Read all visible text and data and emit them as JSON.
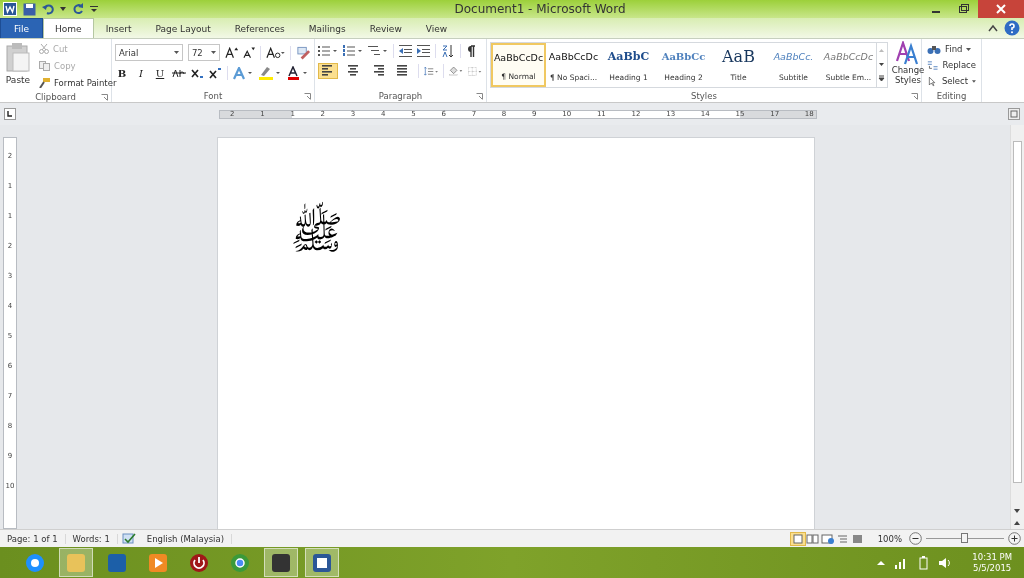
{
  "window": {
    "title": "Document1 - Microsoft Word"
  },
  "tabs": [
    {
      "label": "File",
      "kind": "file",
      "selected": false
    },
    {
      "label": "Home",
      "kind": "tab",
      "selected": true
    },
    {
      "label": "Insert",
      "kind": "tab",
      "selected": false
    },
    {
      "label": "Page Layout",
      "kind": "tab",
      "selected": false
    },
    {
      "label": "References",
      "kind": "tab",
      "selected": false
    },
    {
      "label": "Mailings",
      "kind": "tab",
      "selected": false
    },
    {
      "label": "Review",
      "kind": "tab",
      "selected": false
    },
    {
      "label": "View",
      "kind": "tab",
      "selected": false
    }
  ],
  "clipboard": {
    "paste": "Paste",
    "cut": "Cut",
    "copy": "Copy",
    "format_painter": "Format Painter",
    "label": "Clipboard"
  },
  "font": {
    "name": "Arial",
    "size": "72",
    "label": "Font",
    "bold": "B",
    "italic": "I",
    "underline": "U"
  },
  "paragraph": {
    "label": "Paragraph",
    "alignments": [
      {
        "kind": "left",
        "selected": true
      },
      {
        "kind": "center",
        "selected": false
      },
      {
        "kind": "right",
        "selected": false
      },
      {
        "kind": "justify",
        "selected": false
      }
    ]
  },
  "styles": {
    "label": "Styles",
    "items": [
      {
        "sample": "AaBbCcDc",
        "name": "¶ Normal",
        "kind": "normal",
        "selected": true
      },
      {
        "sample": "AaBbCcDc",
        "name": "¶ No Spaci...",
        "kind": "normal",
        "selected": false
      },
      {
        "sample": "AaBbC",
        "name": "Heading 1",
        "kind": "heading1",
        "selected": false
      },
      {
        "sample": "AaBbCc",
        "name": "Heading 2",
        "kind": "heading2",
        "selected": false
      },
      {
        "sample": "AaB",
        "name": "Title",
        "kind": "title",
        "selected": false
      },
      {
        "sample": "AaBbCc.",
        "name": "Subtitle",
        "kind": "subtitle",
        "selected": false
      },
      {
        "sample": "AaBbCcDc",
        "name": "Subtle Em...",
        "kind": "subtle",
        "selected": false
      }
    ],
    "change": "Change Styles"
  },
  "editing": {
    "label": "Editing",
    "find": "Find",
    "replace": "Replace",
    "select": "Select"
  },
  "ruler": {
    "horizontal": [
      "2",
      "1",
      "1",
      "2",
      "3",
      "4",
      "5",
      "6",
      "7",
      "8",
      "9",
      "10",
      "11",
      "12",
      "13",
      "14",
      "15",
      "17",
      "18"
    ],
    "vertical": [
      "2",
      "1",
      "1",
      "2",
      "3",
      "4",
      "5",
      "6",
      "7",
      "8",
      "9",
      "10"
    ]
  },
  "document": {
    "text": "ﷺ"
  },
  "status_bar": {
    "page": "Page: 1 of 1",
    "words": "Words: 1",
    "language": "English (Malaysia)",
    "zoom": "100%",
    "zoom_slider": {
      "level": 0.5
    }
  },
  "taskbar": {
    "apps": [
      {
        "kind": "ie",
        "highlighted": false
      },
      {
        "kind": "folder",
        "highlighted": true
      },
      {
        "kind": "settings",
        "highlighted": false
      },
      {
        "kind": "media",
        "highlighted": false
      },
      {
        "kind": "power",
        "highlighted": false
      },
      {
        "kind": "chrome",
        "highlighted": false
      },
      {
        "kind": "clapper",
        "highlighted": true
      },
      {
        "kind": "word",
        "highlighted": true
      }
    ],
    "time": "10:31 PM",
    "date": "5/5/2015"
  }
}
